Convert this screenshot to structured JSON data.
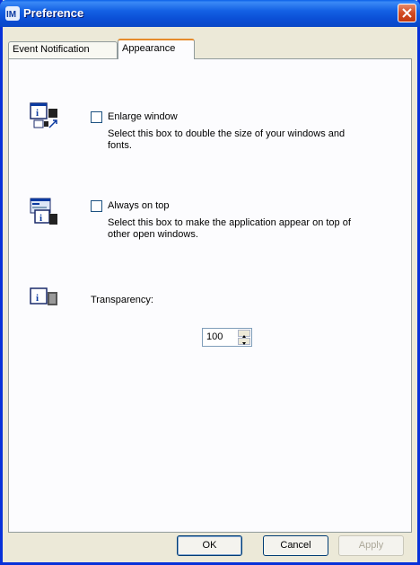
{
  "window": {
    "title": "Preference"
  },
  "tabs": [
    {
      "label": "Event Notification",
      "active": false
    },
    {
      "label": "Appearance",
      "active": true
    }
  ],
  "options": [
    {
      "icon": "enlarge-window-icon",
      "label": "Enlarge window",
      "checked": false,
      "desc_line1": "Select this box to double the size of your windows and",
      "desc_line2": "fonts."
    },
    {
      "icon": "always-on-top-icon",
      "label": "Always on top",
      "checked": false,
      "desc_line1": "Select this box to make the application appear on top of",
      "desc_line2": "other open windows."
    }
  ],
  "transparency": {
    "icon": "transparency-icon",
    "label": "Transparency:",
    "value": "100"
  },
  "buttons": {
    "ok": "OK",
    "cancel": "Cancel",
    "apply": "Apply"
  },
  "colors": {
    "titlebar": "#0a4fd6",
    "tab_highlight": "#e68b2c",
    "close": "#d24b22"
  }
}
